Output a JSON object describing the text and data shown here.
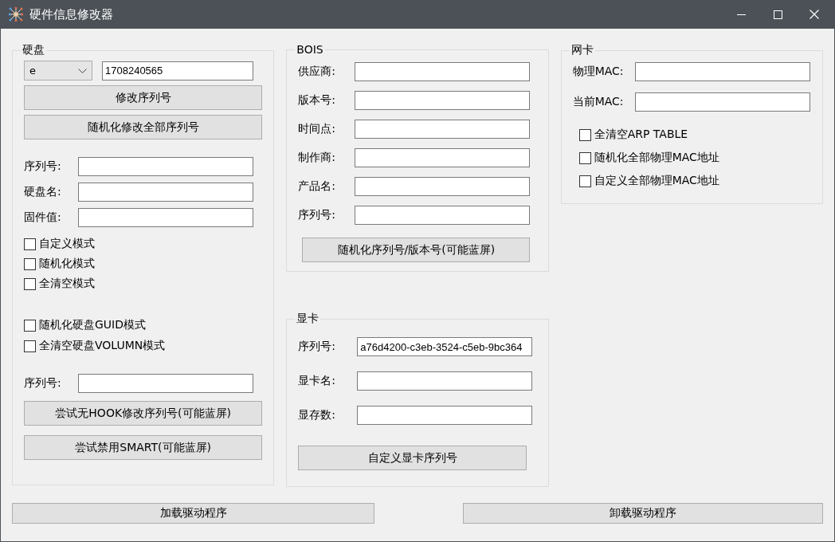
{
  "window": {
    "title": "硬件信息修改器"
  },
  "disk": {
    "title": "硬盘",
    "drive": "e",
    "serial_value": "1708240565",
    "buttons": [
      "修改序列号",
      "随机化修改全部序列号"
    ],
    "fields": [
      {
        "label": "序列号:"
      },
      {
        "label": "硬盘名:"
      },
      {
        "label": "固件值:"
      }
    ],
    "mode_options": [
      {
        "label": "自定义模式",
        "checked": false
      },
      {
        "label": "随机化模式",
        "checked": false
      },
      {
        "label": "全清空模式",
        "checked": false
      }
    ],
    "extra_options": [
      {
        "label": "随机化硬盘GUID模式",
        "checked": false
      },
      {
        "label": "全清空硬盘VOLUMN模式",
        "checked": false
      }
    ],
    "hook_field": {
      "label": "序列号:"
    },
    "hook_buttons": [
      "尝试无HOOK修改序列号(可能蓝屏)",
      "尝试禁用SMART(可能蓝屏)"
    ]
  },
  "bios": {
    "title": "BOIS",
    "fields": [
      {
        "label": "供应商:"
      },
      {
        "label": "版本号:"
      },
      {
        "label": "时间点:"
      },
      {
        "label": "制作商:"
      },
      {
        "label": "产品名:"
      },
      {
        "label": "序列号:"
      }
    ],
    "button": "随机化序列号/版本号(可能蓝屏)"
  },
  "gpu": {
    "title": "显卡",
    "fields": [
      {
        "label": "序列号:",
        "value": "a76d4200-c3eb-3524-c5eb-9bc364"
      },
      {
        "label": "显卡名:"
      },
      {
        "label": "显存数:"
      }
    ],
    "button": "自定义显卡序列号"
  },
  "nic": {
    "title": "网卡",
    "fields": [
      {
        "label": "物理MAC:"
      },
      {
        "label": "当前MAC:"
      }
    ],
    "options": [
      {
        "label": "全清空ARP TABLE",
        "checked": false
      },
      {
        "label": "随机化全部物理MAC地址",
        "checked": false
      },
      {
        "label": "自定义全部物理MAC地址",
        "checked": false
      }
    ]
  },
  "footer_buttons": [
    "加载驱动程序",
    "卸载驱动程序"
  ]
}
